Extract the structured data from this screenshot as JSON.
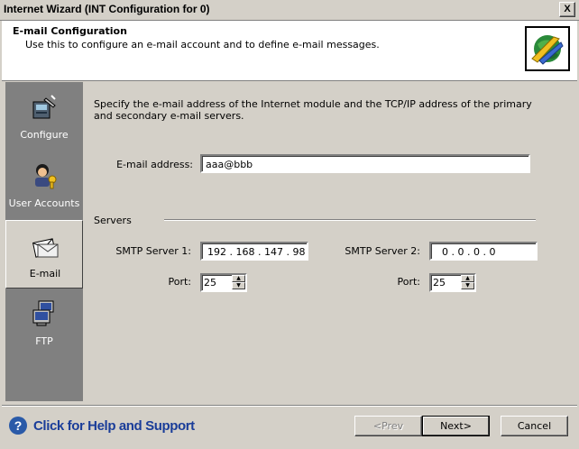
{
  "window": {
    "title": "Internet Wizard (INT Configuration for 0)",
    "close_label": "X"
  },
  "header": {
    "title": "E-mail Configuration",
    "subtitle": "Use this to configure an e-mail account and to define e-mail messages.",
    "logo_icon": "internet-globe-icon"
  },
  "sidebar": {
    "items": [
      {
        "label": "Configure",
        "icon": "configure-icon",
        "active": false
      },
      {
        "label": "User Accounts",
        "icon": "user-accounts-icon",
        "active": false
      },
      {
        "label": "E-mail",
        "icon": "email-icon",
        "active": true
      },
      {
        "label": "FTP",
        "icon": "ftp-icon",
        "active": false
      }
    ]
  },
  "main": {
    "description": "Specify the e-mail address of the Internet module and the TCP/IP address of the primary and secondary e-mail servers.",
    "email_label": "E-mail address:",
    "email_value": "aaa@bbb",
    "servers_label": "Servers",
    "smtp1": {
      "label": "SMTP Server 1:",
      "value": "192 . 168 . 147 .  98",
      "port_label": "Port:",
      "port_value": "25"
    },
    "smtp2": {
      "label": "SMTP Server 2:",
      "value": "0  .  0  .  0  .  0",
      "port_label": "Port:",
      "port_value": "25"
    }
  },
  "footer": {
    "help_label": "Click for Help and Support",
    "prev_label": "<Prev",
    "next_label": "Next>",
    "cancel_label": "Cancel"
  }
}
